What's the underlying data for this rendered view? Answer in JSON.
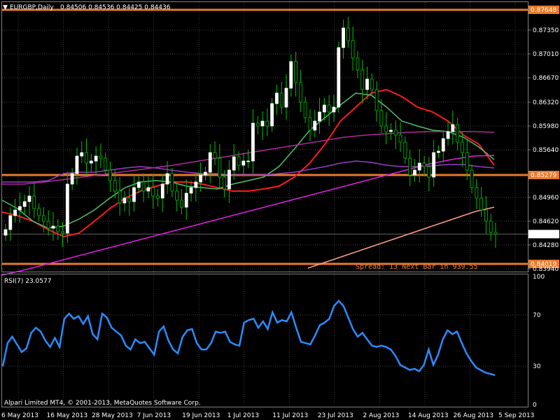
{
  "header": {
    "arrow": "▼",
    "symbol": "EURGBP,Daily",
    "ohlc": "0.84506 0.84536 0.84425 0.84436"
  },
  "rsi_label": "RSI(7) 23.0577",
  "copyright": "Alpari Limited MT4, © 2001-2013, MetaQuotes Software Corp.",
  "spread_text": "Spread: 13   Next Bar in 939.55",
  "colors": {
    "background": "#000000",
    "grid": "#404040",
    "bull_candle": "#ffffff",
    "candle_wick": "#00c000",
    "bear_candle": "#000000",
    "level_line": "#e87a2c",
    "ma_fast": "#ff1a1a",
    "ma_green": "#4fbf6f",
    "ma_magenta": "#e020e0",
    "ma_violet": "#9a3cc8",
    "ma_purple_dark": "#b02a9a",
    "ma_salmon": "#ff9a8a",
    "rsi": "#2a8cff",
    "price_marker": "#ffffff"
  },
  "chart_data": [
    {
      "type": "candlestick",
      "title": "EURGBP,Daily",
      "price_ticks": [
        "0.87350",
        "0.87010",
        "0.86670",
        "0.86320",
        "0.85980",
        "0.85640",
        "0.84960",
        "0.84620",
        "0.84280",
        "0.83940"
      ],
      "ylim": [
        0.839,
        0.8775
      ],
      "x_labels": [
        "6 May 2013",
        "16 May 2013",
        "28 May 2013",
        "7 Jun 2013",
        "19 Jun 2013",
        "1 Jul 2013",
        "11 Jul 2013",
        "23 Jul 2013",
        "2 Aug 2013",
        "14 Aug 2013",
        "26 Aug 2013",
        "5 Sep 2013"
      ],
      "levels": [
        {
          "value": 0.8764,
          "label": "0.87648"
        },
        {
          "value": 0.8528,
          "label": "0.85279"
        },
        {
          "value": 0.8401,
          "label": "0.84019"
        }
      ],
      "current_price": {
        "value": 0.84436,
        "label": "0.84436"
      },
      "close": [
        0.845,
        0.847,
        0.8478,
        0.8483,
        0.849,
        0.8498,
        0.848,
        0.847,
        0.8462,
        0.8452,
        0.8455,
        0.8447,
        0.8445,
        0.8515,
        0.853,
        0.8555,
        0.856,
        0.8545,
        0.8548,
        0.8555,
        0.8552,
        0.8535,
        0.852,
        0.8505,
        0.8488,
        0.8495,
        0.849,
        0.851,
        0.8518,
        0.8505,
        0.851,
        0.8498,
        0.8495,
        0.8515,
        0.853,
        0.8505,
        0.8492,
        0.8482,
        0.8502,
        0.851,
        0.8518,
        0.8528,
        0.8532,
        0.856,
        0.8552,
        0.8525,
        0.8508,
        0.8535,
        0.8554,
        0.8542,
        0.8548,
        0.8548,
        0.8602,
        0.8598,
        0.8605,
        0.8598,
        0.863,
        0.8645,
        0.8625,
        0.8652,
        0.869,
        0.866,
        0.8632,
        0.861,
        0.8592,
        0.8605,
        0.8618,
        0.8628,
        0.8618,
        0.8625,
        0.871,
        0.8738,
        0.872,
        0.8695,
        0.8678,
        0.865,
        0.8665,
        0.865,
        0.862,
        0.8598,
        0.859,
        0.8592,
        0.8585,
        0.8575,
        0.8552,
        0.8528,
        0.8535,
        0.8545,
        0.854,
        0.8525,
        0.856,
        0.8562,
        0.858,
        0.859,
        0.86,
        0.8575,
        0.856,
        0.8535,
        0.851,
        0.8495,
        0.8478,
        0.8462,
        0.8446,
        0.84436
      ],
      "ma_series": [
        {
          "color": "#ff1a1a",
          "values": [
            0.8475,
            0.847,
            0.8462,
            0.845,
            0.844,
            0.8445,
            0.8462,
            0.848,
            0.8495,
            0.8505,
            0.8512,
            0.8518,
            0.8518,
            0.8515,
            0.851,
            0.8505,
            0.8505,
            0.8508,
            0.8512,
            0.8525,
            0.8545,
            0.8572,
            0.8605,
            0.8625,
            0.8645,
            0.865,
            0.864,
            0.8625,
            0.8618,
            0.8605,
            0.8585,
            0.8572,
            0.8542
          ]
        },
        {
          "color": "#4fbf6f",
          "values": [
            0.8492,
            0.848,
            0.8462,
            0.8452,
            0.8455,
            0.8465,
            0.8478,
            0.8495,
            0.851,
            0.8518,
            0.852,
            0.8518,
            0.8512,
            0.851,
            0.8508,
            0.8515,
            0.852,
            0.8525,
            0.854,
            0.8565,
            0.8592,
            0.861,
            0.8628,
            0.8645,
            0.8642,
            0.8625,
            0.8605,
            0.8598,
            0.8592,
            0.859,
            0.8582,
            0.8568,
            0.855
          ]
        },
        {
          "color": "#9a3cc8",
          "values": [
            0.8518,
            0.8518,
            0.8518,
            0.852,
            0.853,
            0.8532,
            0.8532,
            0.8535,
            0.8538,
            0.854,
            0.8538,
            0.8535,
            0.8532,
            0.853,
            0.853,
            0.8528,
            0.8528,
            0.8528,
            0.853,
            0.8532,
            0.8536,
            0.854,
            0.8545,
            0.8548,
            0.8546,
            0.8542,
            0.854,
            0.854,
            0.8541,
            0.8543,
            0.8543,
            0.854,
            0.8538
          ]
        },
        {
          "color": "#b02a9a",
          "values": [
            0.8515,
            0.8515,
            0.8518,
            0.8522,
            0.8526,
            0.853,
            0.8534,
            0.8538,
            0.8542,
            0.8547,
            0.8552,
            0.8557,
            0.8562,
            0.8567,
            0.8572,
            0.8577,
            0.8582,
            0.8585,
            0.8587,
            0.8589,
            0.859,
            0.859,
            0.859,
            0.8589
          ]
        },
        {
          "color": "#e020e0",
          "values": [
            0.8385,
            0.8392,
            0.84,
            0.8408,
            0.8416,
            0.8424,
            0.8432,
            0.844,
            0.8448,
            0.8456,
            0.8464,
            0.8472,
            0.848,
            0.8488,
            0.8496,
            0.8504,
            0.8512,
            0.852,
            0.8528,
            0.8536,
            0.8544,
            0.855,
            0.8555,
            0.8556
          ]
        },
        {
          "color": "#ff9a8a",
          "values": [
            0.8395,
            0.8404,
            0.8413,
            0.8422,
            0.8431,
            0.844,
            0.8449,
            0.8458,
            0.8467,
            0.8476,
            0.8482
          ]
        }
      ]
    },
    {
      "type": "line",
      "title": "RSI(7) 23.0577",
      "y_ticks": [
        "100",
        "70",
        "30",
        "0"
      ],
      "ylim": [
        0,
        100
      ],
      "levels": [
        70,
        30
      ],
      "series": [
        {
          "values": [
            30,
            48,
            53,
            47,
            41,
            44,
            56,
            60,
            57,
            50,
            45,
            52,
            45,
            67,
            71,
            67,
            69,
            63,
            69,
            55,
            51,
            71,
            68,
            60,
            57,
            54,
            46,
            43,
            51,
            48,
            49,
            44,
            39,
            57,
            61,
            50,
            43,
            40,
            53,
            58,
            59,
            48,
            43,
            43,
            48,
            57,
            56,
            57,
            49,
            47,
            46,
            64,
            66,
            67,
            60,
            65,
            59,
            72,
            64,
            66,
            65,
            72,
            60,
            49,
            48,
            47,
            54,
            62,
            64,
            67,
            77,
            81,
            77,
            68,
            59,
            53,
            56,
            51,
            46,
            45,
            46,
            45,
            43,
            38,
            31,
            29,
            27,
            28,
            26,
            31,
            43,
            31,
            39,
            51,
            58,
            55,
            57,
            48,
            40,
            34,
            29,
            27,
            25,
            24,
            23
          ]
        }
      ]
    }
  ]
}
